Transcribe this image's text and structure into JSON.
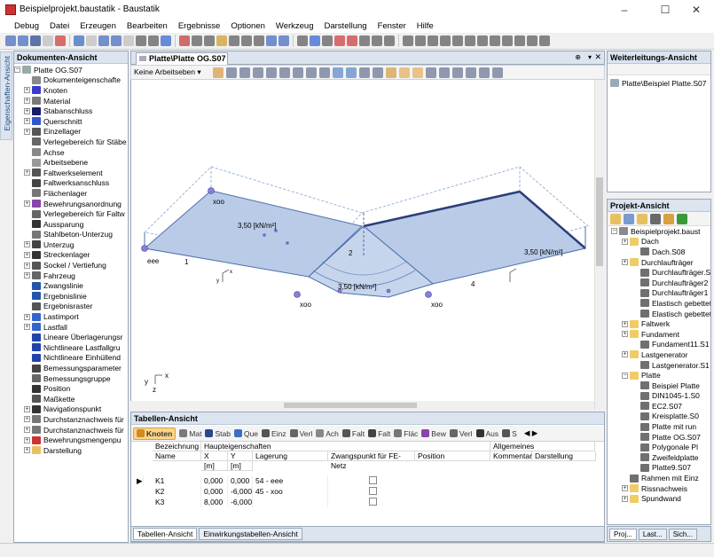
{
  "window": {
    "title": "Beispielprojekt.baustatik - Baustatik"
  },
  "menu": [
    "Debug",
    "Datei",
    "Erzeugen",
    "Bearbeiten",
    "Ergebnisse",
    "Optionen",
    "Werkzeug",
    "Darstellung",
    "Fenster",
    "Hilfe"
  ],
  "side_tab": "Eigenschaften-Ansicht",
  "doc_panel": {
    "title": "Dokumenten-Ansicht",
    "root": "Platte OG.S07",
    "items": [
      {
        "label": "Dokumenteigenschafte",
        "exp": false,
        "color": "#8a8a8a"
      },
      {
        "label": "Knoten",
        "exp": true,
        "color": "#3a3ad0"
      },
      {
        "label": "Material",
        "exp": true,
        "color": "#7a7a7a"
      },
      {
        "label": "Stabanschluss",
        "exp": true,
        "color": "#1a1a6a"
      },
      {
        "label": "Querschnitt",
        "exp": true,
        "color": "#3355cc"
      },
      {
        "label": "Einzellager",
        "exp": true,
        "color": "#555"
      },
      {
        "label": "Verlegebereich für Stäbe",
        "exp": false,
        "color": "#666"
      },
      {
        "label": "Achse",
        "exp": false,
        "color": "#888"
      },
      {
        "label": "Arbeitsebene",
        "exp": false,
        "color": "#999"
      },
      {
        "label": "Faltwerkselement",
        "exp": true,
        "color": "#555"
      },
      {
        "label": "Faltwerksanschluss",
        "exp": false,
        "color": "#444"
      },
      {
        "label": "Flächenlager",
        "exp": false,
        "color": "#777"
      },
      {
        "label": "Bewehrungsanordnung",
        "exp": true,
        "color": "#8844aa"
      },
      {
        "label": "Verlegebereich für Faltw",
        "exp": false,
        "color": "#666"
      },
      {
        "label": "Aussparung",
        "exp": false,
        "color": "#333"
      },
      {
        "label": "Stahlbeton-Unterzug",
        "exp": false,
        "color": "#777"
      },
      {
        "label": "Unterzug",
        "exp": true,
        "color": "#444"
      },
      {
        "label": "Streckenlager",
        "exp": true,
        "color": "#333"
      },
      {
        "label": "Sockel / Vertiefung",
        "exp": true,
        "color": "#555"
      },
      {
        "label": "Fahrzeug",
        "exp": true,
        "color": "#666"
      },
      {
        "label": "Zwangslinie",
        "exp": false,
        "color": "#2255aa"
      },
      {
        "label": "Ergebnislinie",
        "exp": false,
        "color": "#2255aa"
      },
      {
        "label": "Ergebnisraster",
        "exp": false,
        "color": "#555"
      },
      {
        "label": "Lastimport",
        "exp": true,
        "color": "#3366cc"
      },
      {
        "label": "Lastfall",
        "exp": true,
        "color": "#3366cc"
      },
      {
        "label": "Lineare Überlagerungsr",
        "exp": false,
        "color": "#2244aa"
      },
      {
        "label": "Nichtlineare Lastfallgru",
        "exp": false,
        "color": "#2244aa"
      },
      {
        "label": "Nichtlineare Einhüllend",
        "exp": false,
        "color": "#2244aa"
      },
      {
        "label": "Bemessungsparameter",
        "exp": false,
        "color": "#444"
      },
      {
        "label": "Bemessungsgruppe",
        "exp": false,
        "color": "#666"
      },
      {
        "label": "Position",
        "exp": false,
        "color": "#333"
      },
      {
        "label": "Maßkette",
        "exp": false,
        "color": "#555"
      },
      {
        "label": "Navigationspunkt",
        "exp": true,
        "color": "#333"
      },
      {
        "label": "Durchstanznachweis für",
        "exp": true,
        "color": "#777"
      },
      {
        "label": "Durchstanznachweis für",
        "exp": true,
        "color": "#777"
      },
      {
        "label": "Bewehrungsmengenpu",
        "exp": true,
        "color": "#cc3333"
      },
      {
        "label": "Darstellung",
        "exp": true,
        "color": "#e8c060"
      }
    ]
  },
  "view": {
    "tab_title": "Platte\\Platte OG.S07",
    "work_plane": "Keine Arbeitseben",
    "labels": {
      "load1": "3,50 [kN/m²]",
      "load2": "3,50 [kN/m²]",
      "load3": "3,50 [kN/m²]",
      "load4": "3,50 [kN/m²]",
      "load5": "3,50 [kN/m²]",
      "n1": "1",
      "n2": "2",
      "n3": "3",
      "n4": "4",
      "xoo1": "xoo",
      "xoo2": "xoo",
      "xoo3": "xoo",
      "eee": "eee",
      "ax_x": "x",
      "ax_y": "y",
      "ax_z": "z",
      "cx": "x",
      "cy": "y",
      "cz": "z"
    }
  },
  "table_panel": {
    "title": "Tabellen-Ansicht",
    "tabs": [
      "Knoten",
      "Mat",
      "Stab",
      "Que",
      "Einz",
      "Verl",
      "Ach",
      "Falt",
      "Falt",
      "Fläc",
      "Bew",
      "Verl",
      "Aus",
      "S"
    ],
    "group_headers": [
      "Bezeichnung",
      "Haupteigenschaften",
      "Allgemeines"
    ],
    "columns": [
      "Name",
      "X",
      "Y",
      "Lagerung",
      "Zwangspunkt für FE-Netz",
      "Position",
      "Kommentar",
      "Darstellung"
    ],
    "units": [
      "[m]",
      "[m]"
    ],
    "rows": [
      {
        "name": "K1",
        "x": "0,000",
        "y": "0,000",
        "lagerung": "54 - eee"
      },
      {
        "name": "K2",
        "x": "0,000",
        "y": "-6,000",
        "lagerung": "45 - xoo"
      },
      {
        "name": "K3",
        "x": "8,000",
        "y": "-6,000",
        "lagerung": ""
      }
    ],
    "bottom_tabs": [
      "Tabellen-Ansicht",
      "Einwirkungstabellen-Ansicht"
    ]
  },
  "fwd_panel": {
    "title": "Weiterleitungs-Ansicht",
    "item": "Platte\\Beispiel Platte.S07"
  },
  "proj_panel": {
    "title": "Projekt-Ansicht",
    "items": [
      {
        "label": "Beispielprojekt.baust",
        "indent": 0,
        "type": "proj"
      },
      {
        "label": "Dach",
        "indent": 1,
        "type": "folder"
      },
      {
        "label": "Dach.S08",
        "indent": 2,
        "type": "doc"
      },
      {
        "label": "Durchlaufträger",
        "indent": 1,
        "type": "folder"
      },
      {
        "label": "Durchlaufträger.S",
        "indent": 2,
        "type": "doc"
      },
      {
        "label": "Durchlaufträger2",
        "indent": 2,
        "type": "doc"
      },
      {
        "label": "Durchlaufträger1",
        "indent": 2,
        "type": "doc"
      },
      {
        "label": "Elastisch gebettet",
        "indent": 2,
        "type": "doc"
      },
      {
        "label": "Elastisch gebettet",
        "indent": 2,
        "type": "doc"
      },
      {
        "label": "Faltwerk",
        "indent": 1,
        "type": "folder"
      },
      {
        "label": "Fundament",
        "indent": 1,
        "type": "folder"
      },
      {
        "label": "Fundament11.S1",
        "indent": 2,
        "type": "doc"
      },
      {
        "label": "Lastgenerator",
        "indent": 1,
        "type": "folder"
      },
      {
        "label": "Lastgenerator.S1",
        "indent": 2,
        "type": "doc"
      },
      {
        "label": "Platte",
        "indent": 1,
        "type": "folder"
      },
      {
        "label": "Beispiel Platte",
        "indent": 2,
        "type": "doc"
      },
      {
        "label": "DIN1045-1.S0",
        "indent": 2,
        "type": "doc"
      },
      {
        "label": "EC2.S07",
        "indent": 2,
        "type": "doc"
      },
      {
        "label": "Kreisplatte.S0",
        "indent": 2,
        "type": "doc"
      },
      {
        "label": "Platte mit run",
        "indent": 2,
        "type": "doc"
      },
      {
        "label": "Platte OG.S07",
        "indent": 2,
        "type": "doc"
      },
      {
        "label": "Polygonale Pl",
        "indent": 2,
        "type": "doc"
      },
      {
        "label": "Zweifeldplatte",
        "indent": 2,
        "type": "doc"
      },
      {
        "label": "Platte9.S07",
        "indent": 2,
        "type": "doc"
      },
      {
        "label": "Rahmen mit Einz",
        "indent": 1,
        "type": "doc"
      },
      {
        "label": "Rissnachweis",
        "indent": 1,
        "type": "folder"
      },
      {
        "label": "Spundwand",
        "indent": 1,
        "type": "folder"
      }
    ],
    "bottom_tabs": [
      "Proj...",
      "Last...",
      "Sich..."
    ]
  }
}
